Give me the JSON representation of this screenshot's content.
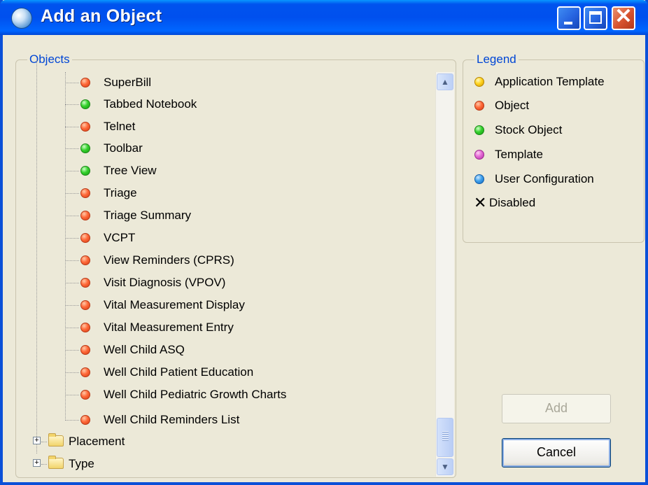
{
  "window": {
    "title": "Add an Object",
    "buttons": {
      "minimize": "minimize",
      "maximize": "maximize",
      "close": "close"
    }
  },
  "objects_group": {
    "title": "Objects",
    "items": [
      {
        "label": "SuperBill",
        "type": "object",
        "color": "#ff5a2a"
      },
      {
        "label": "Tabbed Notebook",
        "type": "stock-object",
        "color": "#2fc42a"
      },
      {
        "label": "Telnet",
        "type": "object",
        "color": "#ff5a2a"
      },
      {
        "label": "Toolbar",
        "type": "stock-object",
        "color": "#2fc42a"
      },
      {
        "label": "Tree View",
        "type": "stock-object",
        "color": "#2fc42a"
      },
      {
        "label": "Triage",
        "type": "object",
        "color": "#ff5a2a"
      },
      {
        "label": "Triage Summary",
        "type": "object",
        "color": "#ff5a2a"
      },
      {
        "label": "VCPT",
        "type": "object",
        "color": "#ff5a2a"
      },
      {
        "label": "View Reminders (CPRS)",
        "type": "object",
        "color": "#ff5a2a"
      },
      {
        "label": "Visit Diagnosis (VPOV)",
        "type": "object",
        "color": "#ff5a2a"
      },
      {
        "label": "Vital Measurement Display",
        "type": "object",
        "color": "#ff5a2a"
      },
      {
        "label": "Vital Measurement Entry",
        "type": "object",
        "color": "#ff5a2a"
      },
      {
        "label": "Well Child ASQ",
        "type": "object",
        "color": "#ff5a2a"
      },
      {
        "label": "Well Child Patient Education",
        "type": "object",
        "color": "#ff5a2a"
      },
      {
        "label": "Well Child Pediatric Growth Charts",
        "type": "object",
        "color": "#ff5a2a"
      },
      {
        "label": "Well Child Reminders List",
        "type": "object",
        "color": "#ff5a2a"
      }
    ],
    "folders": [
      {
        "label": "Placement",
        "expander": "+"
      },
      {
        "label": "Type",
        "expander": "+"
      }
    ]
  },
  "legend_group": {
    "title": "Legend",
    "items": [
      {
        "label": "Application Template",
        "color": "#ffd21a"
      },
      {
        "label": "Object",
        "color": "#ff5a2a"
      },
      {
        "label": "Stock Object",
        "color": "#2fc42a"
      },
      {
        "label": "Template",
        "color": "#e060d0"
      },
      {
        "label": "User Configuration",
        "color": "#3a9ae8"
      },
      {
        "label": "Disabled",
        "icon": "x-mark-icon"
      }
    ]
  },
  "actions": {
    "add_label": "Add",
    "add_enabled": false,
    "cancel_label": "Cancel"
  }
}
